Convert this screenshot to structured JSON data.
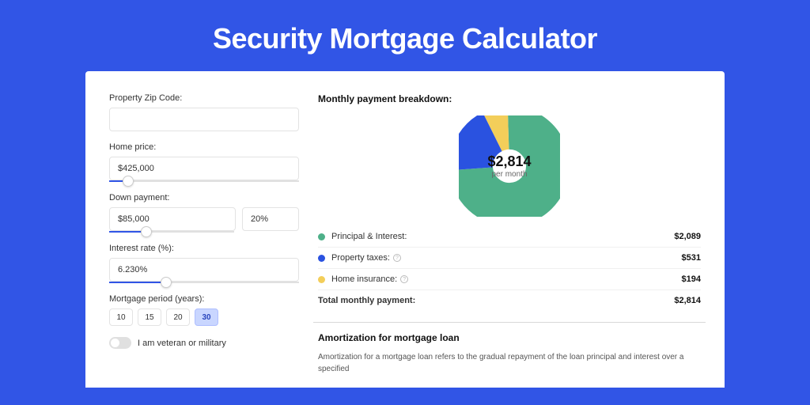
{
  "title": "Security Mortgage Calculator",
  "form": {
    "zip_label": "Property Zip Code:",
    "zip_value": "",
    "home_price_label": "Home price:",
    "home_price_value": "$425,000",
    "down_payment_label": "Down payment:",
    "down_payment_value": "$85,000",
    "down_payment_pct": "20%",
    "interest_label": "Interest rate (%):",
    "interest_value": "6.230%",
    "period_label": "Mortgage period (years):",
    "periods": [
      "10",
      "15",
      "20",
      "30"
    ],
    "period_selected": "30",
    "veteran_label": "I am veteran or military"
  },
  "breakdown": {
    "heading": "Monthly payment breakdown:",
    "total": "$2,814",
    "total_sub": "per month",
    "items": [
      {
        "label": "Principal & Interest:",
        "value": "$2,089",
        "color": "#4eb089",
        "info": false
      },
      {
        "label": "Property taxes:",
        "value": "$531",
        "color": "#2a52e0",
        "info": true
      },
      {
        "label": "Home insurance:",
        "value": "$194",
        "color": "#f3ce5a",
        "info": true
      }
    ],
    "total_label": "Total monthly payment:",
    "total_value": "$2,814"
  },
  "amortization": {
    "heading": "Amortization for mortgage loan",
    "text": "Amortization for a mortgage loan refers to the gradual repayment of the loan principal and interest over a specified"
  },
  "chart_data": {
    "type": "pie",
    "title": "Monthly payment breakdown",
    "series": [
      {
        "name": "Principal & Interest",
        "value": 2089,
        "color": "#4eb089"
      },
      {
        "name": "Property taxes",
        "value": 531,
        "color": "#2a52e0"
      },
      {
        "name": "Home insurance",
        "value": 194,
        "color": "#f3ce5a"
      }
    ],
    "total": 2814,
    "center_label": "$2,814 per month"
  }
}
